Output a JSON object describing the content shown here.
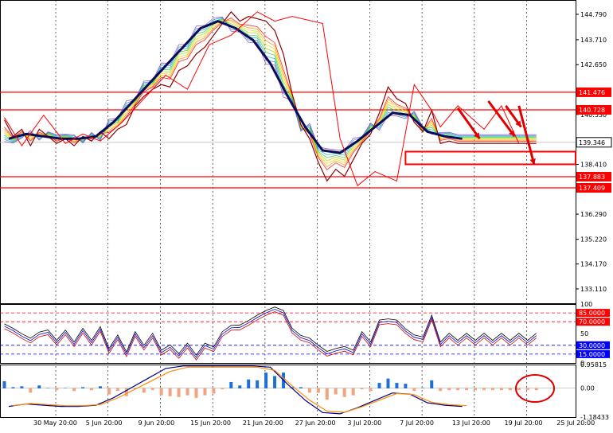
{
  "chart_data": [
    {
      "type": "line",
      "panel": "price",
      "ylim": [
        132.5,
        145.4
      ],
      "grid": true,
      "y_ticks": [
        "144.790",
        "143.710",
        "142.650",
        "141.570",
        "140.530",
        "139.410",
        "138.410",
        "137.350",
        "136.290",
        "135.220",
        "134.170",
        "133.110"
      ],
      "y_tick_values": [
        144.79,
        143.71,
        142.65,
        141.57,
        140.53,
        139.41,
        138.41,
        137.35,
        136.29,
        135.22,
        134.17,
        133.11
      ],
      "x_labels": [
        "30 May 20:00",
        "5 Jun 20:00",
        "9 Jun 20:00",
        "15 Jun 20:00",
        "21 Jun 20:00",
        "27 Jun 20:00",
        "3 Jul 20:00",
        "7 Jul 20:00",
        "13 Jul 20:00",
        "19 Jul 20:00",
        "25 Jul 20:00"
      ],
      "x_label_positions": [
        0,
        12,
        24,
        36,
        48,
        60,
        72,
        84,
        96,
        108,
        120
      ],
      "x_max": 132,
      "price_line": {
        "x": [
          0,
          2,
          4,
          6,
          8,
          10,
          12,
          14,
          16,
          18,
          20,
          22,
          24,
          26,
          28,
          30,
          32,
          34,
          36,
          38,
          40,
          42,
          44,
          46,
          48,
          50,
          52,
          54,
          56,
          58,
          60,
          62,
          64,
          66,
          68,
          70,
          72,
          74,
          76,
          78,
          80,
          82,
          84,
          86,
          88,
          90,
          92,
          94,
          96,
          98,
          100,
          102,
          104,
          106,
          108,
          110,
          112,
          114,
          116,
          118,
          120,
          122
        ],
        "y": [
          140.3,
          139.6,
          139.9,
          139.2,
          139.9,
          139.6,
          139.3,
          139.5,
          139.2,
          139.6,
          139.4,
          139.8,
          139.5,
          139.9,
          140.1,
          140.9,
          141.3,
          141.6,
          141.8,
          141.7,
          142.4,
          142.6,
          143.1,
          143.4,
          143.9,
          144.4,
          144.9,
          144.5,
          144.7,
          144.6,
          144.5,
          144.1,
          143.1,
          141.4,
          140.1,
          139.5,
          138.5,
          137.7,
          138.2,
          137.9,
          138.6,
          139.3,
          139.7,
          140.6,
          141.7,
          141.2,
          141.0,
          140.2,
          139.8,
          140.7,
          139.3,
          139.4,
          139.3,
          139.3,
          139.3,
          139.3,
          139.3,
          139.3,
          139.3,
          139.3,
          139.3,
          139.3
        ]
      },
      "ma_main": {
        "x": [
          0,
          4,
          8,
          12,
          16,
          20,
          24,
          28,
          32,
          36,
          40,
          44,
          48,
          52,
          56,
          60,
          64,
          68,
          72,
          76,
          80,
          84,
          88,
          92,
          96,
          100,
          104
        ],
        "y": [
          139.5,
          139.7,
          139.6,
          139.5,
          139.5,
          139.6,
          140.2,
          141.0,
          141.8,
          142.6,
          143.4,
          144.2,
          144.5,
          144.2,
          143.7,
          142.7,
          141.3,
          140.0,
          139.0,
          138.9,
          139.4,
          140.0,
          140.6,
          140.5,
          139.8,
          139.6,
          139.5
        ]
      },
      "horizontal_lines": [
        {
          "value": 141.476,
          "label": "141.476",
          "color": "#ff0000"
        },
        {
          "value": 140.728,
          "label": "140.728",
          "color": "#ff0000"
        },
        {
          "value": 137.883,
          "label": "137.883",
          "color": "#ff0000"
        },
        {
          "value": 137.409,
          "label": "137.409",
          "color": "#ff0000"
        },
        {
          "value": 139.346,
          "label": "139.346",
          "color": "#c0c0c0"
        }
      ],
      "zigzag": {
        "x": [
          0,
          4,
          9,
          14,
          18,
          22,
          27,
          33,
          37,
          42,
          47,
          52,
          58,
          62,
          66,
          73,
          77,
          81,
          85,
          90,
          94,
          98,
          100,
          104,
          110,
          114,
          118
        ],
        "y": [
          140.4,
          139.2,
          140.5,
          139.3,
          139.7,
          139.4,
          140.2,
          141.4,
          142.2,
          141.6,
          143.5,
          143.9,
          144.9,
          144.5,
          144.7,
          144.4,
          139.5,
          137.5,
          138.1,
          137.7,
          141.8,
          140.7,
          140.0,
          140.9,
          139.9,
          140.9,
          139.3
        ]
      },
      "support_box": {
        "y_low": 138.41,
        "y_high": 138.95
      }
    },
    {
      "type": "line",
      "panel": "stochastic",
      "ylim": [
        0,
        100
      ],
      "y_ticks": [
        "100",
        "85.0000",
        "70.0000",
        "50",
        "30.0000",
        "15.0000",
        "0"
      ],
      "y_tick_values": [
        100,
        85,
        70,
        50,
        30,
        15,
        0
      ],
      "levels": [
        {
          "value": 85,
          "label": "85.0000",
          "color": "#ff0000"
        },
        {
          "value": 70,
          "label": "70.0000",
          "color": "#ff0000"
        },
        {
          "value": 30,
          "label": "30.0000",
          "color": "#0000ff"
        },
        {
          "value": 15,
          "label": "15.0000",
          "color": "#0000ff"
        }
      ]
    },
    {
      "type": "bar",
      "panel": "macd",
      "ylim": [
        -1.18433,
        0.95815
      ],
      "y_ticks": [
        "0.95815",
        "0.00",
        "-1.18433"
      ],
      "y_tick_values": [
        0.95815,
        0.0,
        -1.18433
      ]
    }
  ],
  "colors": {
    "support": "#ff0000",
    "pivot": "#c0c0c0",
    "ma_main": "#0b0b5e",
    "zigzag": "#ff0000",
    "histogram_pos": "#1f6fd6",
    "histogram_neg": "#f4a37c",
    "oversold": "#0000ff",
    "overbought": "#ff0000"
  }
}
